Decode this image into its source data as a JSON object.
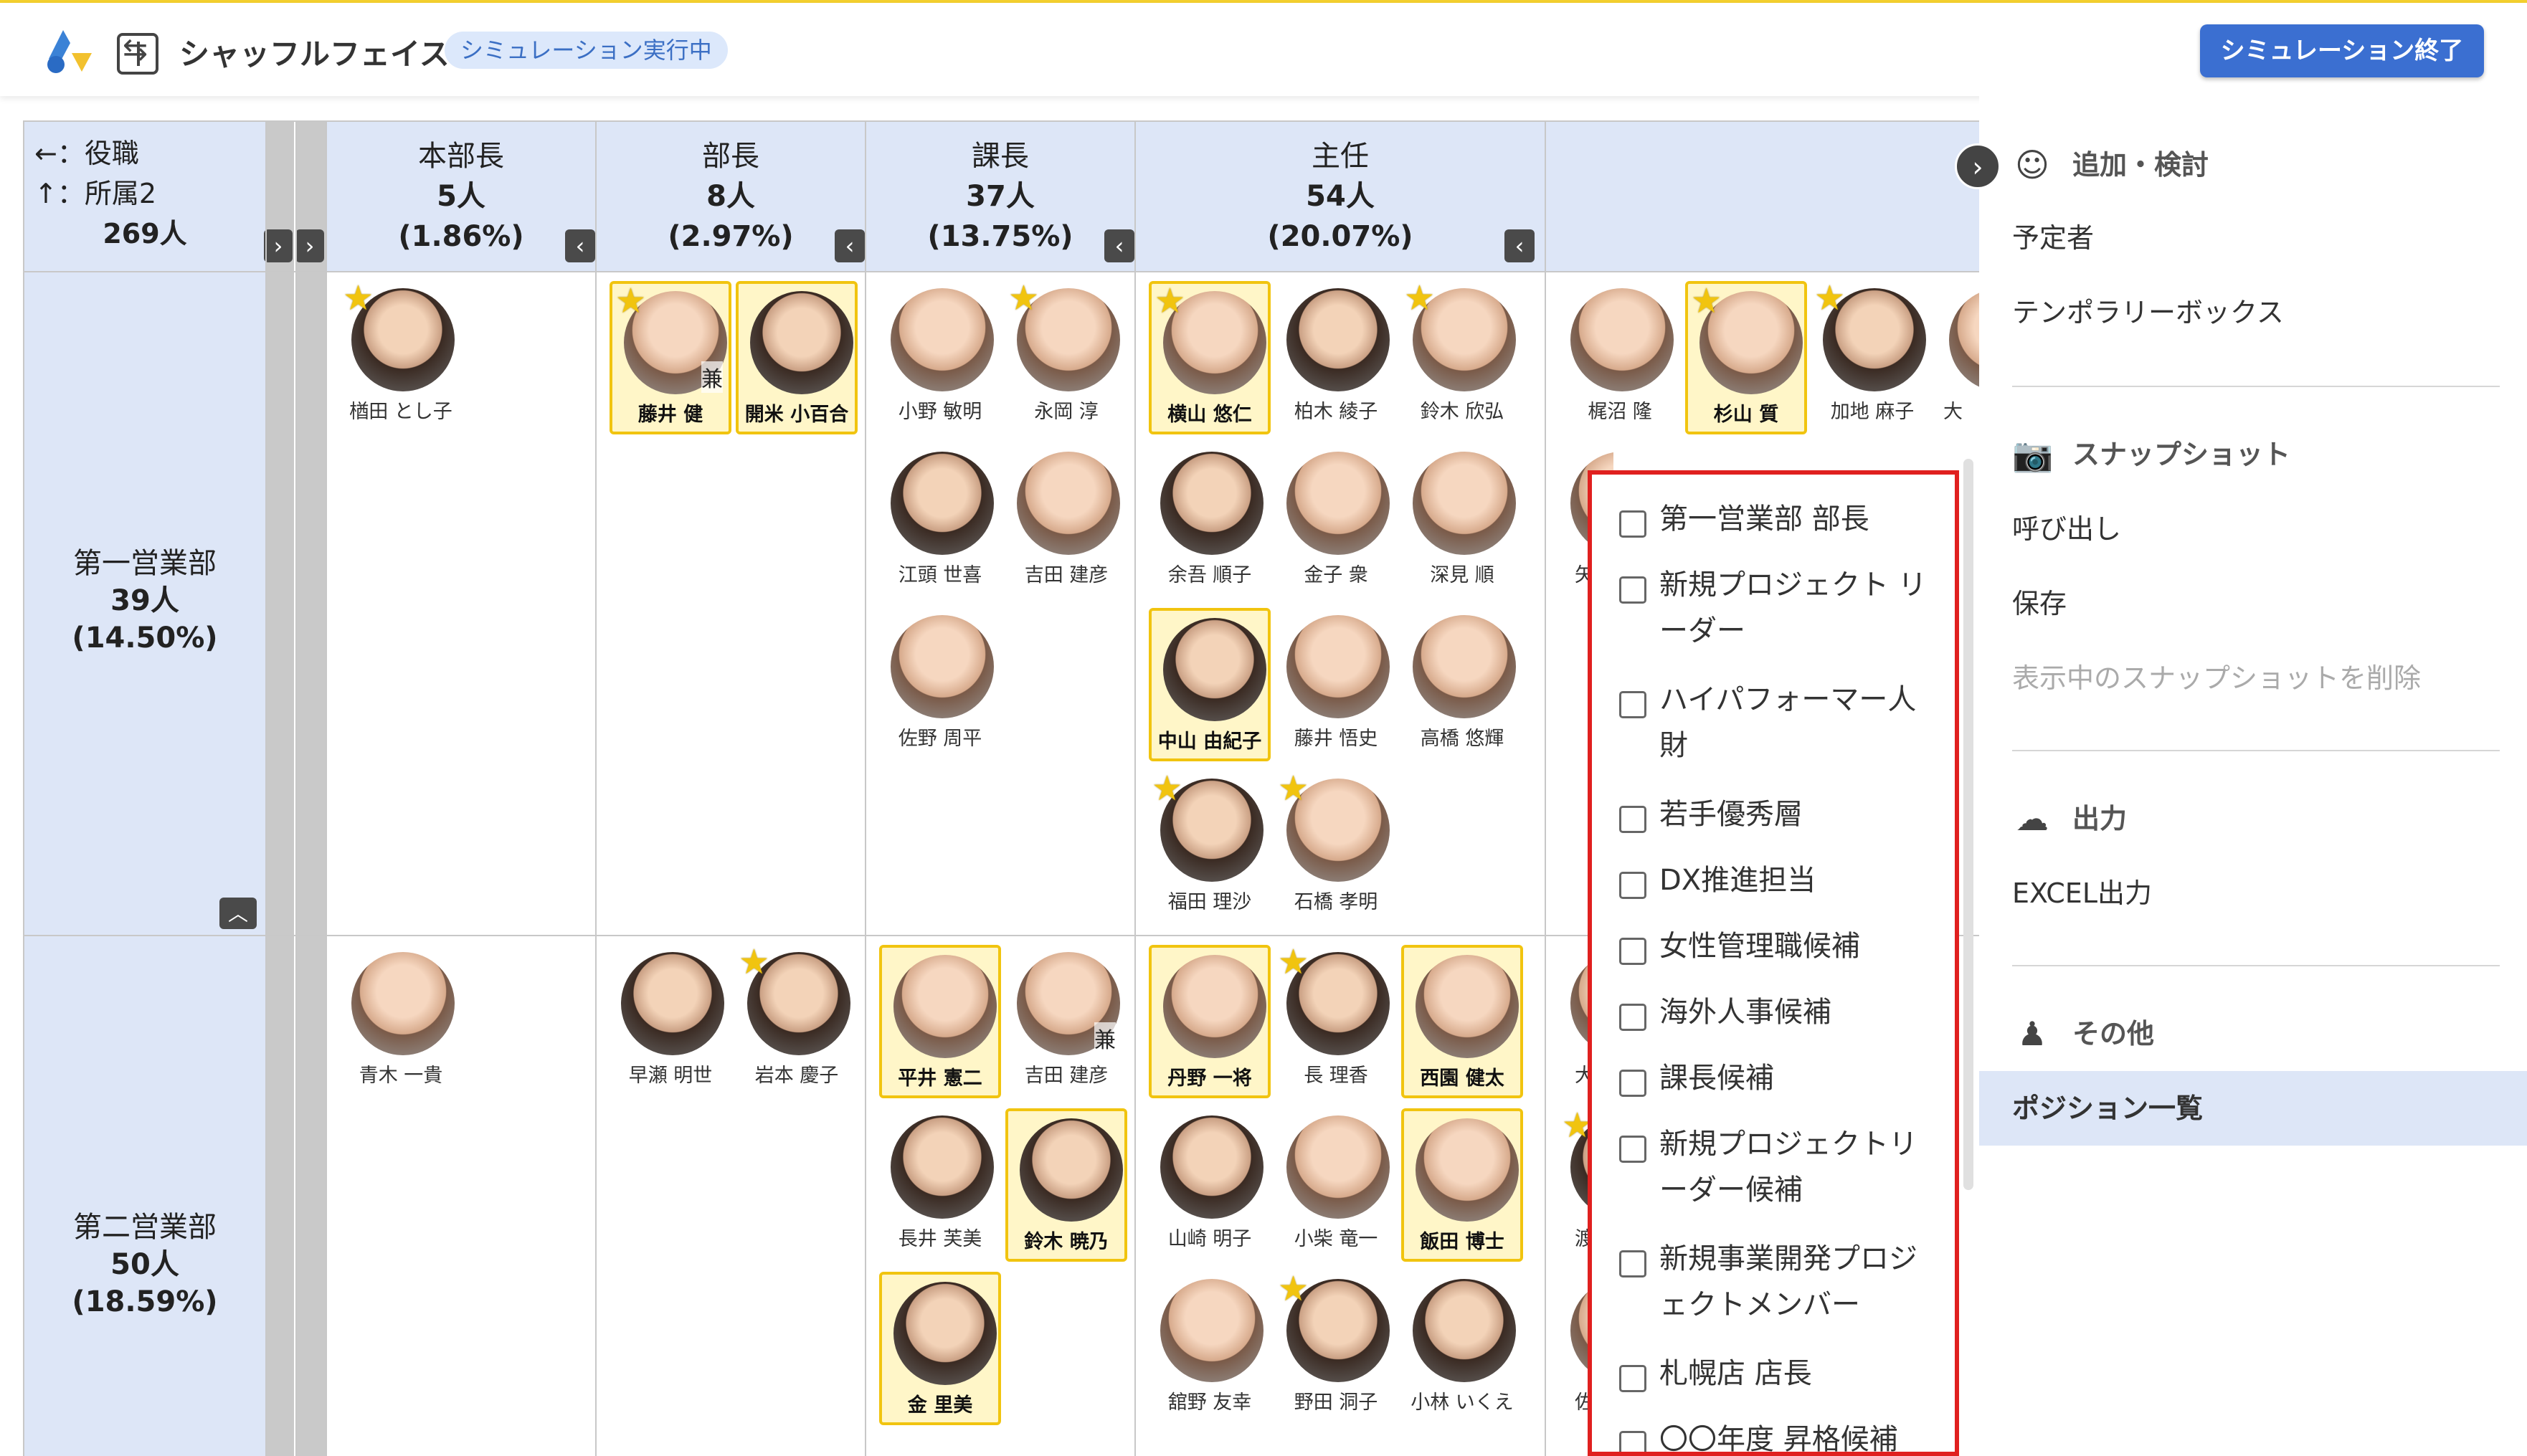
{
  "header": {
    "app_title": "シャッフルフェイス",
    "status_badge": "シミュレーション実行中",
    "end_button": "シミュレーション終了"
  },
  "grid": {
    "corner": {
      "line1": "←：役職",
      "line2": "↑：所属2",
      "total": "269人"
    },
    "columns": [
      {
        "title": "本部長",
        "count": "5人",
        "pct": "(1.86%)"
      },
      {
        "title": "部長",
        "count": "8人",
        "pct": "(2.97%)"
      },
      {
        "title": "課長",
        "count": "37人",
        "pct": "(13.75%)"
      },
      {
        "title": "主任",
        "count": "54人",
        "pct": "(20.07%)"
      }
    ],
    "rows": [
      {
        "name": "第一営業部",
        "count": "39人",
        "pct": "(14.50%)"
      },
      {
        "name": "第二営業部",
        "count": "50人",
        "pct": "(18.59%)"
      }
    ],
    "people": {
      "r1_honbucho": [
        "楢田 とし子"
      ],
      "r1_bucho": [
        "藤井 健",
        "開米 小百合"
      ],
      "r1_kacho": [
        "小野 敏明",
        "永岡 淳",
        "江頭 世喜",
        "吉田 建彦",
        "佐野 周平"
      ],
      "r1_shunin": [
        "横山 悠仁",
        "柏木 綾子",
        "鈴木 欣弘",
        "余吾 順子",
        "金子 衆",
        "深見 順",
        "中山 由紀子",
        "藤井 悟史",
        "高橋 悠輝",
        "福田 理沙",
        "石橋 孝明"
      ],
      "r1_next": [
        "梶沼 隆",
        "杉山 質",
        "加地 麻子",
        "大",
        "矢"
      ],
      "r2_honbucho": [
        "青木 一貴"
      ],
      "r2_bucho": [
        "早瀬 明世",
        "岩本 慶子"
      ],
      "r2_kacho": [
        "平井 憲二",
        "吉田 建彦",
        "長井 芙美",
        "鈴木 暁乃",
        "金 里美"
      ],
      "r2_shunin": [
        "丹野 一将",
        "長 理香",
        "西園 健太",
        "山崎 明子",
        "小柴 竜一",
        "飯田 博士",
        "舘野 友幸",
        "野田 洞子",
        "小林 いくえ"
      ],
      "r2_next": [
        "大",
        "渡",
        "佐"
      ],
      "kan_mark": "兼"
    }
  },
  "popup": {
    "items": [
      "第一営業部 部長",
      "新規プロジェクト リーダー",
      "ハイパフォーマー人財",
      "若手優秀層",
      "DX推進担当",
      "女性管理職候補",
      "海外人事候補",
      "課長候補",
      "新規プロジェクトリーダー候補",
      "新規事業開発プロジェクトメンバー",
      "札幌店 店長",
      "〇〇年度 昇格候補"
    ]
  },
  "sidebar": {
    "add_section": "追加・検討",
    "add_items": [
      "予定者",
      "テンポラリーボックス"
    ],
    "snapshot_section": "スナップショット",
    "snapshot_items": [
      "呼び出し",
      "保存"
    ],
    "snapshot_delete": "表示中のスナップショットを削除",
    "output_section": "出力",
    "output_items": [
      "EXCEL出力"
    ],
    "other_section": "その他",
    "other_items": [
      "ポジション一覧"
    ]
  },
  "colors": {
    "accent": "#3b6fd1",
    "header_cell": "#dde6f7",
    "highlight": "#f1c40f",
    "popup_border": "#e0201f"
  }
}
